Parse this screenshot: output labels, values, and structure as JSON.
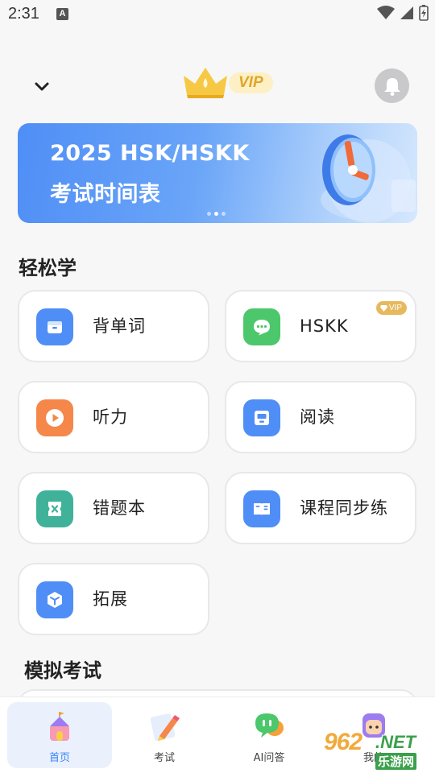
{
  "status_bar": {
    "time": "2:31",
    "notification_icon": "A"
  },
  "header": {
    "vip_text": "VIP"
  },
  "banner": {
    "line1": "2025 HSK/HSKK",
    "line2": "考试时间表"
  },
  "sections": {
    "easy_learn": "轻松学",
    "mock_exam": "模拟考试"
  },
  "cards": [
    {
      "label": "背单词",
      "icon": "card-icon",
      "color": "#4f8ef6"
    },
    {
      "label": "HSKK",
      "icon": "chat-icon",
      "color": "#4cc76c",
      "badge": "VIP"
    },
    {
      "label": "听力",
      "icon": "play-icon",
      "color": "#f5874a"
    },
    {
      "label": "阅读",
      "icon": "reader-icon",
      "color": "#4f8ef6"
    },
    {
      "label": "错题本",
      "icon": "mistake-icon",
      "color": "#40b29a"
    },
    {
      "label": "课程同步练",
      "icon": "book-icon",
      "color": "#4f8ef6"
    },
    {
      "label": "拓展",
      "icon": "cube-icon",
      "color": "#4f8ef6"
    }
  ],
  "nav": [
    {
      "label": "首页",
      "icon": "home-castle-icon",
      "active": true
    },
    {
      "label": "考试",
      "icon": "pencil-icon",
      "active": false
    },
    {
      "label": "AI问答",
      "icon": "ai-chat-icon",
      "active": false
    },
    {
      "label": "我的",
      "icon": "profile-icon",
      "active": false
    }
  ],
  "watermark": {
    "brand": "962",
    "domain": ".NET",
    "name": "乐游网"
  }
}
